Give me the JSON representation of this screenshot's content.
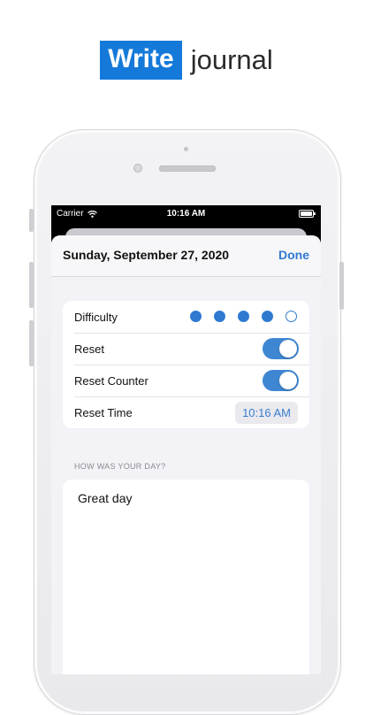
{
  "headline": {
    "highlight": "Write",
    "rest": "journal"
  },
  "status_bar": {
    "carrier": "Carrier",
    "time": "10:16 AM"
  },
  "nav": {
    "title": "Sunday, September 27, 2020",
    "done_label": "Done"
  },
  "settings": {
    "difficulty": {
      "label": "Difficulty",
      "value": 4,
      "max": 5
    },
    "reset": {
      "label": "Reset",
      "on": true
    },
    "reset_counter": {
      "label": "Reset Counter",
      "on": true
    },
    "reset_time": {
      "label": "Reset Time",
      "value": "10:16 AM"
    }
  },
  "journal": {
    "section_header": "HOW WAS YOUR DAY?",
    "text": "Great day"
  },
  "colors": {
    "accent": "#2f7ad0",
    "brand": "#1479d9",
    "toggle_on": "#3f86d2"
  }
}
